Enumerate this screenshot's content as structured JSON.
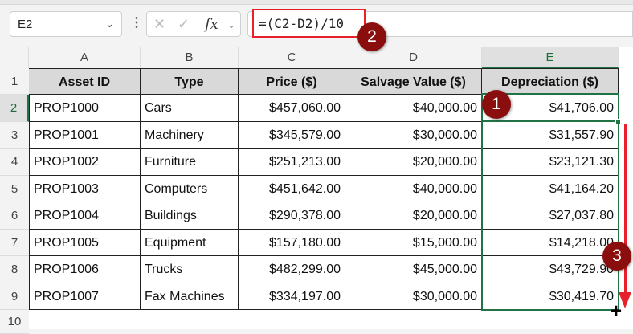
{
  "namebox": {
    "value": "E2"
  },
  "formula_bar": {
    "formula": "=(C2-D2)/10",
    "cancel": "✕",
    "enter": "✓",
    "fx": "fx"
  },
  "badges": [
    "1",
    "2",
    "3"
  ],
  "columns": [
    "A",
    "B",
    "C",
    "D",
    "E"
  ],
  "rows": [
    "1",
    "2",
    "3",
    "4",
    "5",
    "6",
    "7",
    "8",
    "9",
    "10"
  ],
  "headers": [
    "Asset ID",
    "Type",
    "Price ($)",
    "Salvage Value ($)",
    "Depreciation ($)"
  ],
  "data": [
    [
      "PROP1000",
      "Cars",
      "$457,060.00",
      "$40,000.00",
      "$41,706.00"
    ],
    [
      "PROP1001",
      "Machinery",
      "$345,579.00",
      "$30,000.00",
      "$31,557.90"
    ],
    [
      "PROP1002",
      "Furniture",
      "$251,213.00",
      "$20,000.00",
      "$23,121.30"
    ],
    [
      "PROP1003",
      "Computers",
      "$451,642.00",
      "$40,000.00",
      "$41,164.20"
    ],
    [
      "PROP1004",
      "Buildings",
      "$290,378.00",
      "$20,000.00",
      "$27,037.80"
    ],
    [
      "PROP1005",
      "Equipment",
      "$157,180.00",
      "$15,000.00",
      "$14,218.00"
    ],
    [
      "PROP1006",
      "Trucks",
      "$482,299.00",
      "$45,000.00",
      "$43,729.90"
    ],
    [
      "PROP1007",
      "Fax Machines",
      "$334,197.00",
      "$30,000.00",
      "$30,419.70"
    ]
  ],
  "colors": {
    "selection": "#217346",
    "highlight": "#e8202a",
    "badge": "#8b0e0e"
  }
}
